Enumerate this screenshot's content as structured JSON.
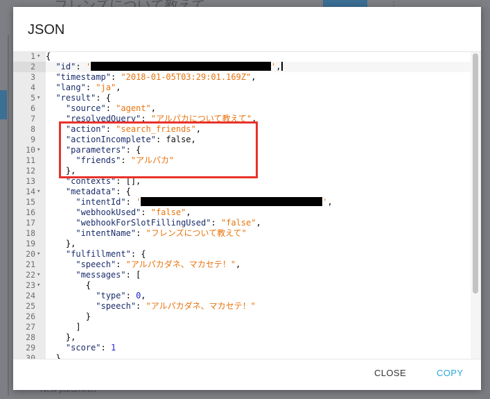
{
  "background": {
    "title_fragment": "フレンズについて教えて",
    "bottom_text": "New parameter"
  },
  "dialog": {
    "title": "JSON",
    "close_label": "CLOSE",
    "copy_label": "COPY"
  },
  "colors": {
    "highlight_border": "#e8312a",
    "copy_accent": "#2aa7dc",
    "string": "#e8730d",
    "key": "#1a2c6b"
  },
  "code_lines": [
    {
      "n": "1",
      "fold": true,
      "tokens": [
        {
          "t": "p",
          "v": "{"
        }
      ]
    },
    {
      "n": "2",
      "tokens": [
        {
          "t": "p",
          "v": "  "
        },
        {
          "t": "k",
          "v": "\"id\""
        },
        {
          "t": "p",
          "v": ": "
        },
        {
          "t": "s",
          "v": "'"
        },
        {
          "t": "r",
          "w": 260
        },
        {
          "t": "s",
          "v": "'"
        },
        {
          "t": "p",
          "v": ","
        },
        {
          "t": "c"
        }
      ]
    },
    {
      "n": "3",
      "tokens": [
        {
          "t": "p",
          "v": "  "
        },
        {
          "t": "k",
          "v": "\"timestamp\""
        },
        {
          "t": "p",
          "v": ": "
        },
        {
          "t": "s",
          "v": "\"2018-01-05T03:29:01.169Z\""
        },
        {
          "t": "p",
          "v": ","
        }
      ]
    },
    {
      "n": "4",
      "tokens": [
        {
          "t": "p",
          "v": "  "
        },
        {
          "t": "k",
          "v": "\"lang\""
        },
        {
          "t": "p",
          "v": ": "
        },
        {
          "t": "s",
          "v": "\"ja\""
        },
        {
          "t": "p",
          "v": ","
        }
      ]
    },
    {
      "n": "5",
      "fold": true,
      "tokens": [
        {
          "t": "p",
          "v": "  "
        },
        {
          "t": "k",
          "v": "\"result\""
        },
        {
          "t": "p",
          "v": ": {"
        }
      ]
    },
    {
      "n": "6",
      "tokens": [
        {
          "t": "p",
          "v": "    "
        },
        {
          "t": "k",
          "v": "\"source\""
        },
        {
          "t": "p",
          "v": ": "
        },
        {
          "t": "s",
          "v": "\"agent\""
        },
        {
          "t": "p",
          "v": ","
        }
      ]
    },
    {
      "n": "7",
      "tokens": [
        {
          "t": "p",
          "v": "    "
        },
        {
          "t": "k",
          "v": "\"resolvedQuery\""
        },
        {
          "t": "p",
          "v": ": "
        },
        {
          "t": "s",
          "v": "\"アルパカについて教えて\""
        },
        {
          "t": "p",
          "v": ","
        }
      ]
    },
    {
      "n": "8",
      "tokens": [
        {
          "t": "p",
          "v": "    "
        },
        {
          "t": "k",
          "v": "\"action\""
        },
        {
          "t": "p",
          "v": ": "
        },
        {
          "t": "s",
          "v": "\"search_friends\""
        },
        {
          "t": "p",
          "v": ","
        }
      ]
    },
    {
      "n": "9",
      "tokens": [
        {
          "t": "p",
          "v": "    "
        },
        {
          "t": "k",
          "v": "\"actionIncomplete\""
        },
        {
          "t": "p",
          "v": ": "
        },
        {
          "t": "b",
          "v": "false"
        },
        {
          "t": "p",
          "v": ","
        }
      ]
    },
    {
      "n": "10",
      "fold": true,
      "tokens": [
        {
          "t": "p",
          "v": "    "
        },
        {
          "t": "k",
          "v": "\"parameters\""
        },
        {
          "t": "p",
          "v": ": {"
        }
      ]
    },
    {
      "n": "11",
      "tokens": [
        {
          "t": "p",
          "v": "      "
        },
        {
          "t": "k",
          "v": "\"friends\""
        },
        {
          "t": "p",
          "v": ": "
        },
        {
          "t": "s",
          "v": "\"アルパカ\""
        }
      ]
    },
    {
      "n": "12",
      "tokens": [
        {
          "t": "p",
          "v": "    },"
        }
      ]
    },
    {
      "n": "13",
      "tokens": [
        {
          "t": "p",
          "v": "    "
        },
        {
          "t": "k",
          "v": "\"contexts\""
        },
        {
          "t": "p",
          "v": ": [],"
        }
      ]
    },
    {
      "n": "14",
      "fold": true,
      "tokens": [
        {
          "t": "p",
          "v": "    "
        },
        {
          "t": "k",
          "v": "\"metadata\""
        },
        {
          "t": "p",
          "v": ": {"
        }
      ]
    },
    {
      "n": "15",
      "tokens": [
        {
          "t": "p",
          "v": "      "
        },
        {
          "t": "k",
          "v": "\"intentId\""
        },
        {
          "t": "p",
          "v": ": "
        },
        {
          "t": "s",
          "v": "'"
        },
        {
          "t": "r",
          "w": 262
        },
        {
          "t": "s",
          "v": "'"
        },
        {
          "t": "p",
          "v": ","
        }
      ]
    },
    {
      "n": "16",
      "tokens": [
        {
          "t": "p",
          "v": "      "
        },
        {
          "t": "k",
          "v": "\"webhookUsed\""
        },
        {
          "t": "p",
          "v": ": "
        },
        {
          "t": "s",
          "v": "\"false\""
        },
        {
          "t": "p",
          "v": ","
        }
      ]
    },
    {
      "n": "17",
      "tokens": [
        {
          "t": "p",
          "v": "      "
        },
        {
          "t": "k",
          "v": "\"webhookForSlotFillingUsed\""
        },
        {
          "t": "p",
          "v": ": "
        },
        {
          "t": "s",
          "v": "\"false\""
        },
        {
          "t": "p",
          "v": ","
        }
      ]
    },
    {
      "n": "18",
      "tokens": [
        {
          "t": "p",
          "v": "      "
        },
        {
          "t": "k",
          "v": "\"intentName\""
        },
        {
          "t": "p",
          "v": ": "
        },
        {
          "t": "s",
          "v": "\"フレンズについて教えて\""
        }
      ]
    },
    {
      "n": "19",
      "tokens": [
        {
          "t": "p",
          "v": "    },"
        }
      ]
    },
    {
      "n": "20",
      "fold": true,
      "tokens": [
        {
          "t": "p",
          "v": "    "
        },
        {
          "t": "k",
          "v": "\"fulfillment\""
        },
        {
          "t": "p",
          "v": ": {"
        }
      ]
    },
    {
      "n": "21",
      "tokens": [
        {
          "t": "p",
          "v": "      "
        },
        {
          "t": "k",
          "v": "\"speech\""
        },
        {
          "t": "p",
          "v": ": "
        },
        {
          "t": "s",
          "v": "\"アルパカダネ、マカセテ！\""
        },
        {
          "t": "p",
          "v": ","
        }
      ]
    },
    {
      "n": "22",
      "fold": true,
      "tokens": [
        {
          "t": "p",
          "v": "      "
        },
        {
          "t": "k",
          "v": "\"messages\""
        },
        {
          "t": "p",
          "v": ": ["
        }
      ]
    },
    {
      "n": "23",
      "fold": true,
      "tokens": [
        {
          "t": "p",
          "v": "        {"
        }
      ]
    },
    {
      "n": "24",
      "tokens": [
        {
          "t": "p",
          "v": "          "
        },
        {
          "t": "k",
          "v": "\"type\""
        },
        {
          "t": "p",
          "v": ": "
        },
        {
          "t": "n",
          "v": "0"
        },
        {
          "t": "p",
          "v": ","
        }
      ]
    },
    {
      "n": "25",
      "tokens": [
        {
          "t": "p",
          "v": "          "
        },
        {
          "t": "k",
          "v": "\"speech\""
        },
        {
          "t": "p",
          "v": ": "
        },
        {
          "t": "s",
          "v": "\"アルパカダネ、マカセテ！\""
        }
      ]
    },
    {
      "n": "26",
      "tokens": [
        {
          "t": "p",
          "v": "        }"
        }
      ]
    },
    {
      "n": "27",
      "tokens": [
        {
          "t": "p",
          "v": "      ]"
        }
      ]
    },
    {
      "n": "28",
      "tokens": [
        {
          "t": "p",
          "v": "    },"
        }
      ]
    },
    {
      "n": "29",
      "tokens": [
        {
          "t": "p",
          "v": "    "
        },
        {
          "t": "k",
          "v": "\"score\""
        },
        {
          "t": "p",
          "v": ": "
        },
        {
          "t": "n",
          "v": "1"
        }
      ]
    },
    {
      "n": "30",
      "tokens": [
        {
          "t": "p",
          "v": "  },"
        }
      ]
    }
  ]
}
